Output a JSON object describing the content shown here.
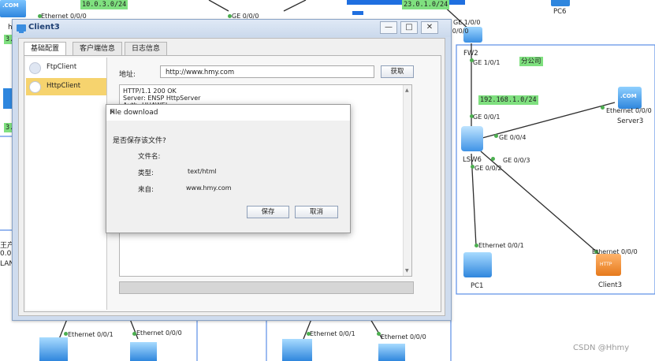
{
  "topology": {
    "networks": {
      "net_10_0_3": "10.0.3.0/24",
      "net_23_0_1": "23.0.1.0/24",
      "net_192_168_1": "192.168.1.0/24"
    },
    "zone_label": "分公司",
    "devices": {
      "pc6": "PC6",
      "fw2": "FW2",
      "lsw6": "LSW6",
      "server3": "Server3",
      "pc1": "PC1",
      "client3": "Client3"
    },
    "ports": {
      "eth000_topleft": "Ethernet 0/0/0",
      "ge000_top": "GE 0/0/0",
      "ge100_fw": "GE 1/0/0",
      "ge000_fw": "GE 0/0/0",
      "ge101_fw": "GE 1/0/1",
      "ge001_lsw": "GE 0/0/1",
      "ge004_lsw": "GE 0/0/4",
      "ge003_lsw": "GE 0/0/3",
      "ge002_lsw": "GE 0/0/2",
      "eth000_server3": "Ethernet 0/0/0",
      "eth001_pc1": "Ethernet 0/0/1",
      "eth000_client3": "Ethernet 0/0/0",
      "eth001_bottom1": "Ethernet 0/0/1",
      "eth000_bottom1": "Ethernet 0/0/0",
      "eth001_bottom2": "Ethernet 0/0/1",
      "eth000_bottom2": "Ethernet 0/0/0"
    },
    "left_fragments": {
      "frag_h": "h",
      "frag_3a": "3.",
      "frag_3b": "3.",
      "frag_wang": "王产",
      "frag_0": "0.0",
      "frag_lan": "LAN"
    },
    "icon_text": {
      "com": ".COM",
      "http": "HTTP"
    }
  },
  "window": {
    "title": "Client3",
    "tabs": [
      "基础配置",
      "客户端信息",
      "日志信息"
    ],
    "active_tab": 0,
    "client_list": [
      "FtpClient",
      "HttpClient"
    ],
    "selected_client": 1,
    "address_label": "地址:",
    "url": "http://www.hmy.com",
    "fetch_button": "获取",
    "response_lines": [
      "HTTP/1.1 200 OK",
      "Server: ENSP HttpServer",
      "Auth: HUAWEI"
    ]
  },
  "dialog": {
    "title": "File download",
    "question": "是否保存该文件?",
    "filename_label": "文件名:",
    "filename_value": "",
    "type_label": "类型:",
    "type_value": "text/html",
    "from_label": "来自:",
    "from_value": "www.hmy.com",
    "save_button": "保存",
    "cancel_button": "取消"
  },
  "watermark": "CSDN @Hhmy",
  "colors": {
    "network_label_bg": "#7fe07f",
    "selected_item": "#f6d36e",
    "link_line": "#2e2e2e",
    "zone_border": "#5a8ee6"
  }
}
